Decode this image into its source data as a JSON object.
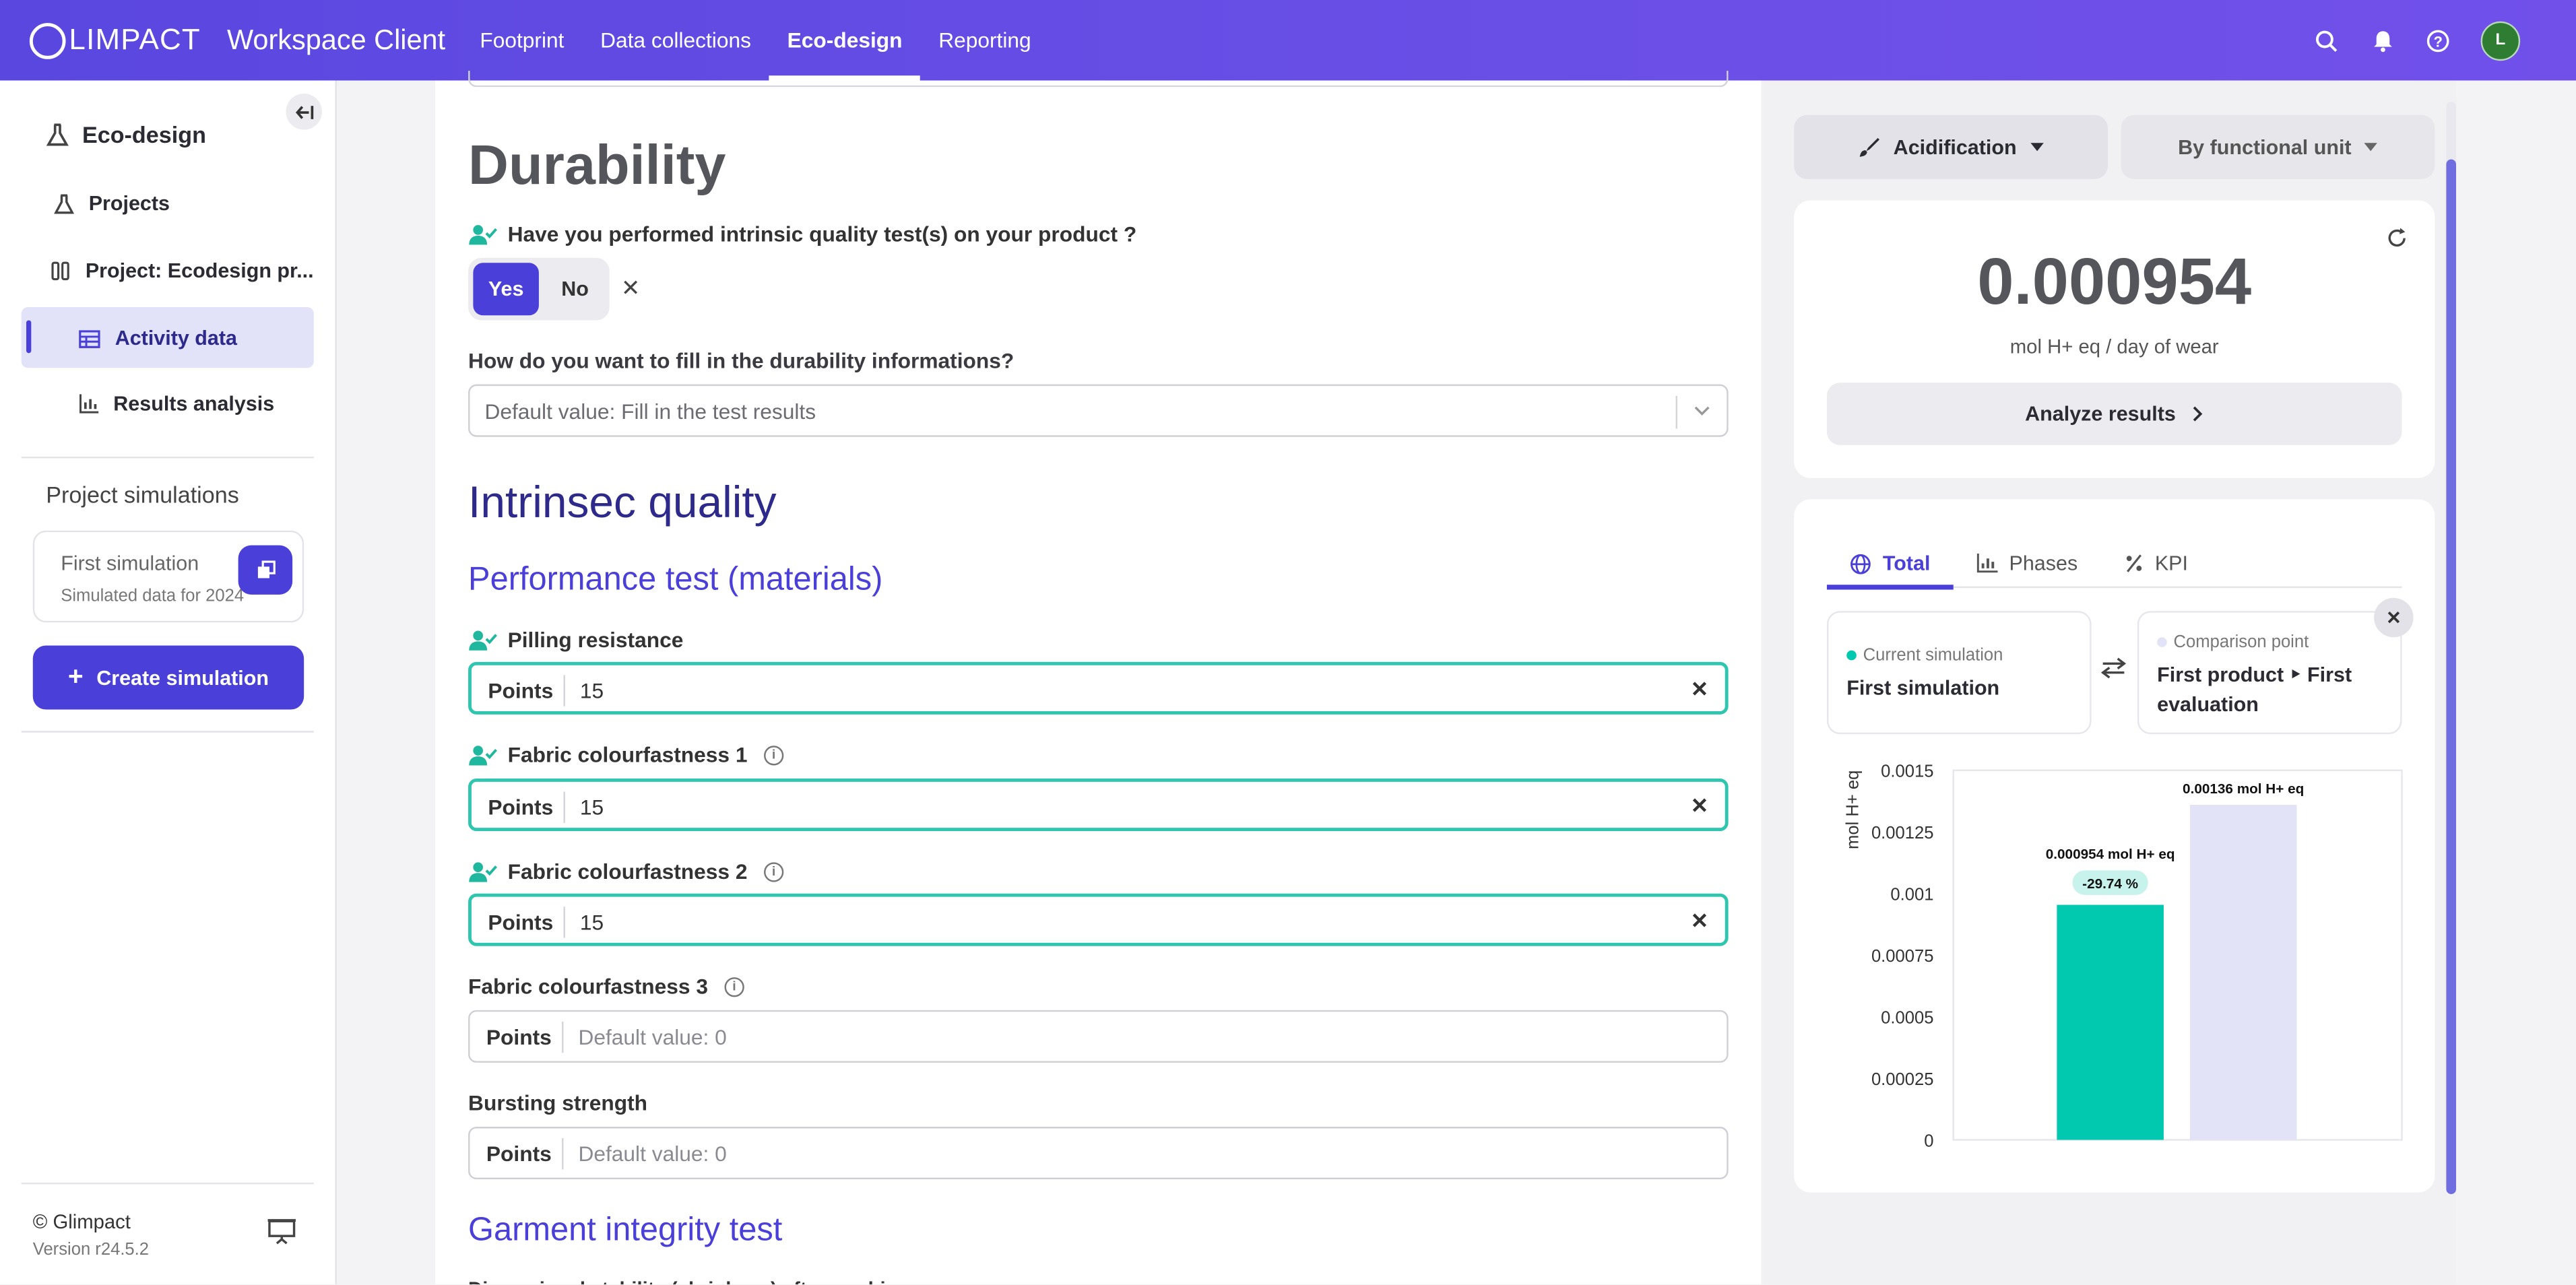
{
  "topbar": {
    "logo_text": "LIMPACT",
    "app_title": "Workspace Client",
    "nav": [
      "Footprint",
      "Data collections",
      "Eco-design",
      "Reporting"
    ],
    "nav_active": "Eco-design",
    "avatar_initial": "L"
  },
  "sidebar": {
    "title": "Eco-design",
    "items": [
      {
        "label": "Projects",
        "icon": "flask-icon"
      },
      {
        "label": "Project: Ecodesign pr...",
        "icon": "flasks-icon"
      },
      {
        "label": "Activity data",
        "icon": "table-icon",
        "active": true
      },
      {
        "label": "Results analysis",
        "icon": "bar-chart-icon"
      }
    ],
    "simulations_title": "Project simulations",
    "simulation": {
      "name": "First simulation",
      "subtitle": "Simulated data for 2024"
    },
    "create_button": "Create simulation",
    "footer_copyright": "© Glimpact",
    "footer_version": "Version r24.5.2"
  },
  "main": {
    "section_title": "Durability",
    "question1": "Have you performed intrinsic quality test(s) on your product ?",
    "yes_label": "Yes",
    "no_label": "No",
    "selected_answer": "Yes",
    "question2": "How do you want to fill in the durability informations?",
    "select_value": "Default value: Fill in the test results",
    "intrinsic_title": "Intrinsec quality",
    "performance_title": "Performance test (materials)",
    "fields": [
      {
        "label": "Pilling resistance",
        "prefix": "Points",
        "value": "15",
        "filled": true,
        "info": false
      },
      {
        "label": "Fabric colourfastness 1",
        "prefix": "Points",
        "value": "15",
        "filled": true,
        "info": true
      },
      {
        "label": "Fabric colourfastness 2",
        "prefix": "Points",
        "value": "15",
        "filled": true,
        "info": true
      },
      {
        "label": "Fabric colourfastness 3",
        "prefix": "Points",
        "placeholder": "Default value: 0",
        "filled": false,
        "info": true
      },
      {
        "label": "Bursting strength",
        "prefix": "Points",
        "placeholder": "Default value: 0",
        "filled": false,
        "info": false
      }
    ],
    "garment_title": "Garment integrity test",
    "cut_off_text": "Dimensional stability (shrinkage) after washing"
  },
  "right_panel": {
    "indicator_button": "Acidification",
    "unit_button": "By functional unit",
    "result_value": "0.000954",
    "result_unit": "mol H+ eq / day of wear",
    "analyze_button": "Analyze results",
    "tabs": [
      "Total",
      "Phases",
      "KPI"
    ],
    "active_tab": "Total",
    "current_label": "Current simulation",
    "current_name": "First simulation",
    "comparison_label": "Comparison point",
    "comparison_name_line1": "First product ‣ First",
    "comparison_name_line2": "evaluation",
    "colors": {
      "current": "#00c9b0",
      "comparison": "#e3e3f8",
      "accent": "#4a3fd8"
    }
  },
  "chart_data": {
    "type": "bar",
    "categories": [
      "Current simulation",
      "Comparison point"
    ],
    "values": [
      0.000954,
      0.00136
    ],
    "value_labels": [
      "0.000954 mol H+ eq",
      "0.00136 mol H+ eq"
    ],
    "delta_label": "-29.74 %",
    "ylabel": "mol H+ eq",
    "ylim": [
      0,
      0.0015
    ],
    "yticks": [
      0,
      0.00025,
      0.0005,
      0.00075,
      0.001,
      0.00125,
      0.0015
    ],
    "ytick_labels": [
      "0",
      "0.00025",
      "0.0005",
      "0.00075",
      "0.001",
      "0.00125",
      "0.0015"
    ],
    "colors": [
      "#00c9b0",
      "#e3e3f8"
    ],
    "grid": false
  }
}
